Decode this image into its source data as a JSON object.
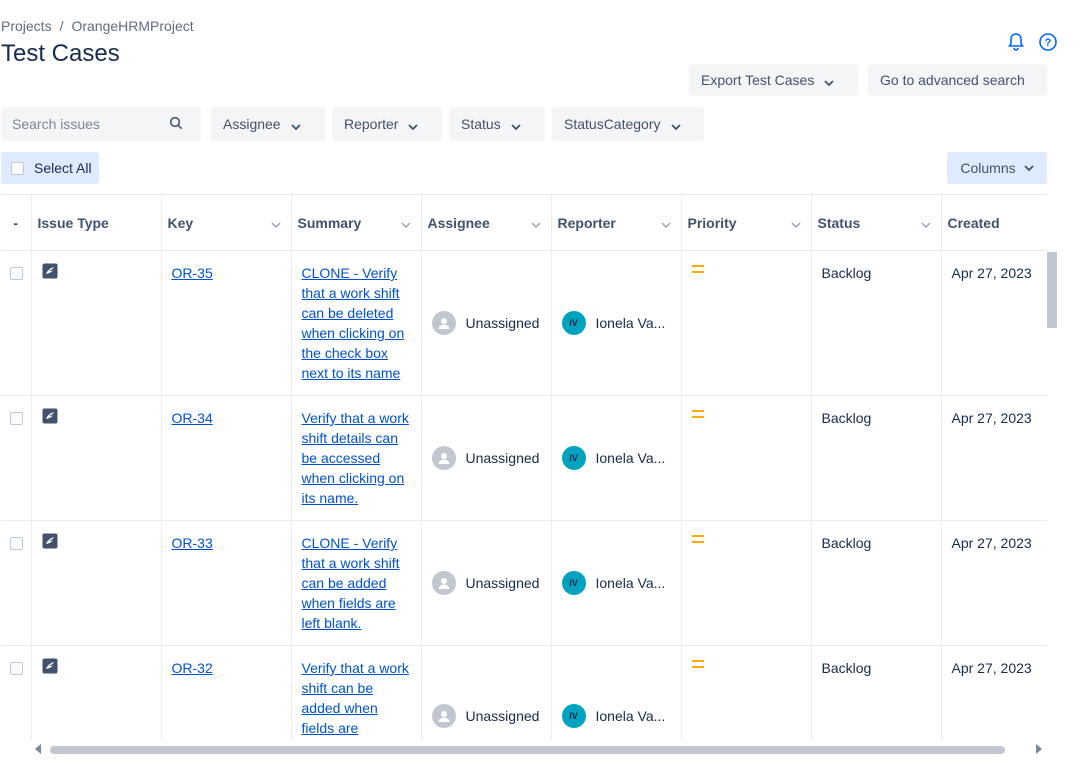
{
  "breadcrumb": {
    "projects": "Projects",
    "separator": "/",
    "project": "OrangeHRMProject"
  },
  "page_title": "Test Cases",
  "header_actions": {
    "export": "Export Test Cases",
    "advanced_search": "Go to advanced search"
  },
  "filters": {
    "search_placeholder": "Search issues",
    "assignee": "Assignee",
    "reporter": "Reporter",
    "status": "Status",
    "status_category": "StatusCategory"
  },
  "select_all": "Select All",
  "columns_button": "Columns",
  "table": {
    "headers": [
      "-",
      "Issue Type",
      "Key",
      "Summary",
      "Assignee",
      "Reporter",
      "Priority",
      "Status",
      "Created"
    ],
    "rows": [
      {
        "key": "OR-35",
        "summary": "CLONE - Verify that a work shift can be deleted when clicking on the check box next to its name",
        "assignee": "Unassigned",
        "reporter_initials": "IV",
        "reporter": "Ionela Va...",
        "status": "Backlog",
        "created": "Apr 27, 2023"
      },
      {
        "key": "OR-34",
        "summary": "Verify that a work shift details can be accessed when clicking on its name.",
        "assignee": "Unassigned",
        "reporter_initials": "IV",
        "reporter": "Ionela Va...",
        "status": "Backlog",
        "created": "Apr 27, 2023"
      },
      {
        "key": "OR-33",
        "summary": "CLONE - Verify that a work shift can be added when fields are left blank.",
        "assignee": "Unassigned",
        "reporter_initials": "IV",
        "reporter": "Ionela Va...",
        "status": "Backlog",
        "created": "Apr 27, 2023"
      },
      {
        "key": "OR-32",
        "summary": "Verify that a work shift can be added when fields are completed with",
        "assignee": "Unassigned",
        "reporter_initials": "IV",
        "reporter": "Ionela Va...",
        "status": "Backlog",
        "created": "Apr 27, 2023"
      }
    ]
  },
  "colors": {
    "link": "#0052cc",
    "priority_medium": "#ffab00",
    "avatar": "#00a3bf",
    "selected_bg": "#deebff"
  },
  "icons": {
    "notifications": "bell-icon",
    "help": "help-icon",
    "search": "search-icon",
    "issue_type": "test-case-icon"
  }
}
